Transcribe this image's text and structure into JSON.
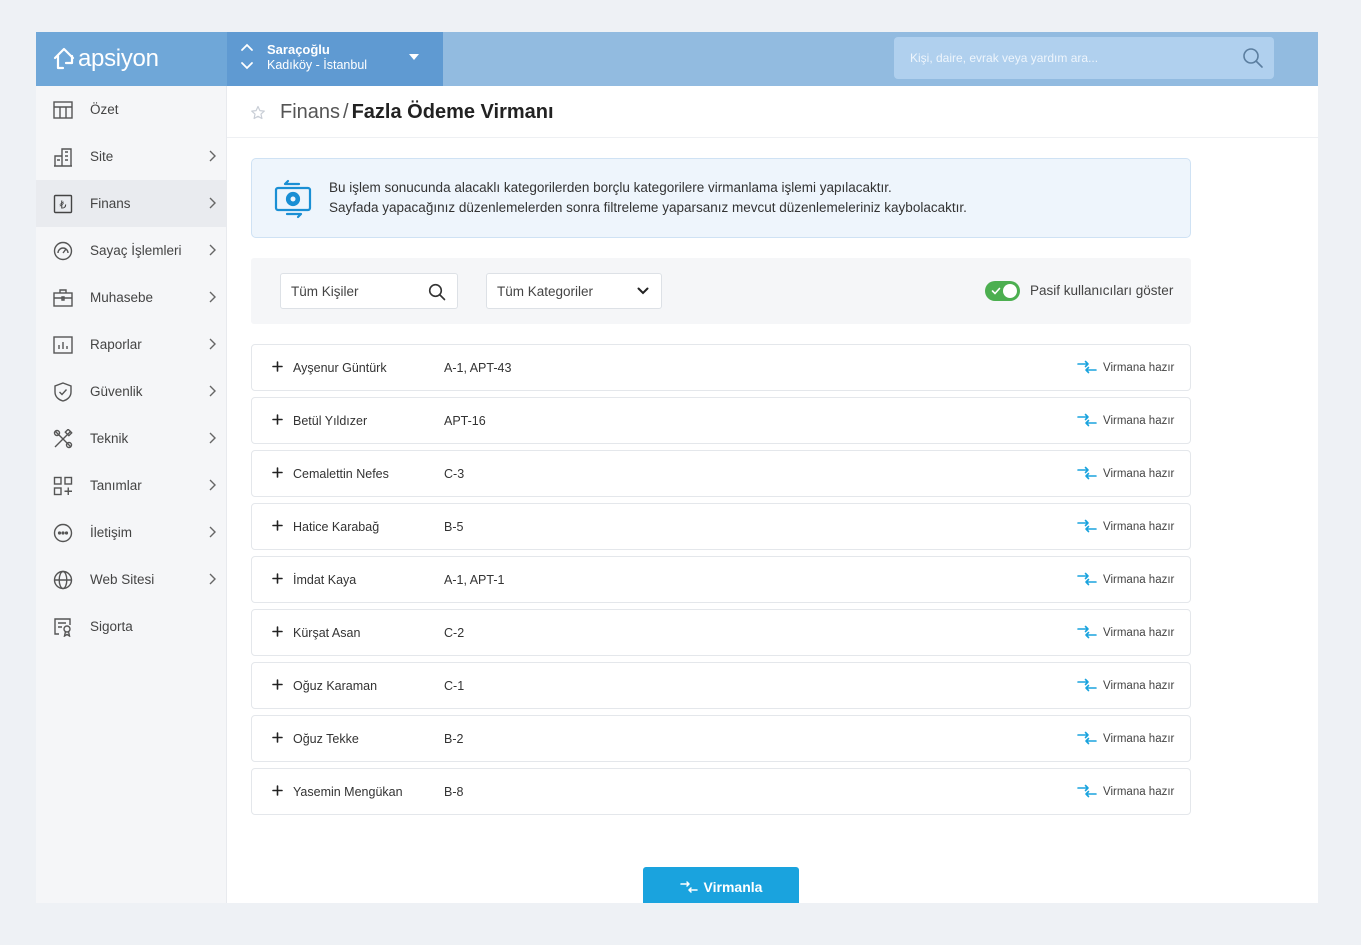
{
  "brand": {
    "name": "apsiyon"
  },
  "site": {
    "name": "Saraçoğlu",
    "location": "Kadıköy - İstanbul"
  },
  "search": {
    "placeholder": "Kişi, daire, evrak veya yardım ara..."
  },
  "sidebar": {
    "items": [
      {
        "label": "Özet",
        "icon": "grid-table-icon",
        "has_arrow": false,
        "active": false
      },
      {
        "label": "Site",
        "icon": "building-icon",
        "has_arrow": true,
        "active": false
      },
      {
        "label": "Finans",
        "icon": "lira-icon",
        "has_arrow": true,
        "active": true
      },
      {
        "label": "Sayaç İşlemleri",
        "icon": "gauge-icon",
        "has_arrow": true,
        "active": false
      },
      {
        "label": "Muhasebe",
        "icon": "briefcase-icon",
        "has_arrow": true,
        "active": false
      },
      {
        "label": "Raporlar",
        "icon": "bar-chart-icon",
        "has_arrow": true,
        "active": false
      },
      {
        "label": "Güvenlik",
        "icon": "shield-icon",
        "has_arrow": true,
        "active": false
      },
      {
        "label": "Teknik",
        "icon": "tools-icon",
        "has_arrow": true,
        "active": false
      },
      {
        "label": "Tanımlar",
        "icon": "grid-plus-icon",
        "has_arrow": true,
        "active": false
      },
      {
        "label": "İletişim",
        "icon": "chat-icon",
        "has_arrow": true,
        "active": false
      },
      {
        "label": "Web Sitesi",
        "icon": "globe-icon",
        "has_arrow": true,
        "active": false
      },
      {
        "label": "Sigorta",
        "icon": "certificate-icon",
        "has_arrow": false,
        "active": false
      }
    ]
  },
  "breadcrumb": {
    "parent": "Finans",
    "separator": "/",
    "current": "Fazla Ödeme Virmanı"
  },
  "info": {
    "line1": "Bu işlem sonucunda alacaklı kategorilerden borçlu kategorilere virmanlama işlemi yapılacaktır.",
    "line2": "Sayfada yapacağınız düzenlemelerden sonra filtreleme yaparsanız mevcut düzenlemeleriniz kaybolacaktır."
  },
  "filters": {
    "person_placeholder": "Tüm Kişiler",
    "category_value": "Tüm Kategoriler",
    "passive_toggle_label": "Pasif kullanıcıları göster",
    "passive_toggle_on": true
  },
  "rows": [
    {
      "name": "Ayşenur Güntürk",
      "unit": "A-1, APT-43",
      "status": "Virmana hazır"
    },
    {
      "name": "Betül Yıldızer",
      "unit": "APT-16",
      "status": "Virmana hazır"
    },
    {
      "name": "Cemalettin Nefes",
      "unit": "C-3",
      "status": "Virmana hazır"
    },
    {
      "name": "Hatice Karabağ",
      "unit": "B-5",
      "status": "Virmana hazır"
    },
    {
      "name": "İmdat Kaya",
      "unit": "A-1, APT-1",
      "status": "Virmana hazır"
    },
    {
      "name": "Kürşat Asan",
      "unit": "C-2",
      "status": "Virmana hazır"
    },
    {
      "name": "Oğuz Karaman",
      "unit": "C-1",
      "status": "Virmana hazır"
    },
    {
      "name": "Oğuz Tekke",
      "unit": "B-2",
      "status": "Virmana hazır"
    },
    {
      "name": "Yasemin Mengükan",
      "unit": "B-8",
      "status": "Virmana hazır"
    }
  ],
  "actions": {
    "transfer_label": "Virmanla"
  },
  "colors": {
    "accent": "#1aa3de",
    "topbar": "#92bbe0",
    "toggle_on": "#4caf50"
  }
}
